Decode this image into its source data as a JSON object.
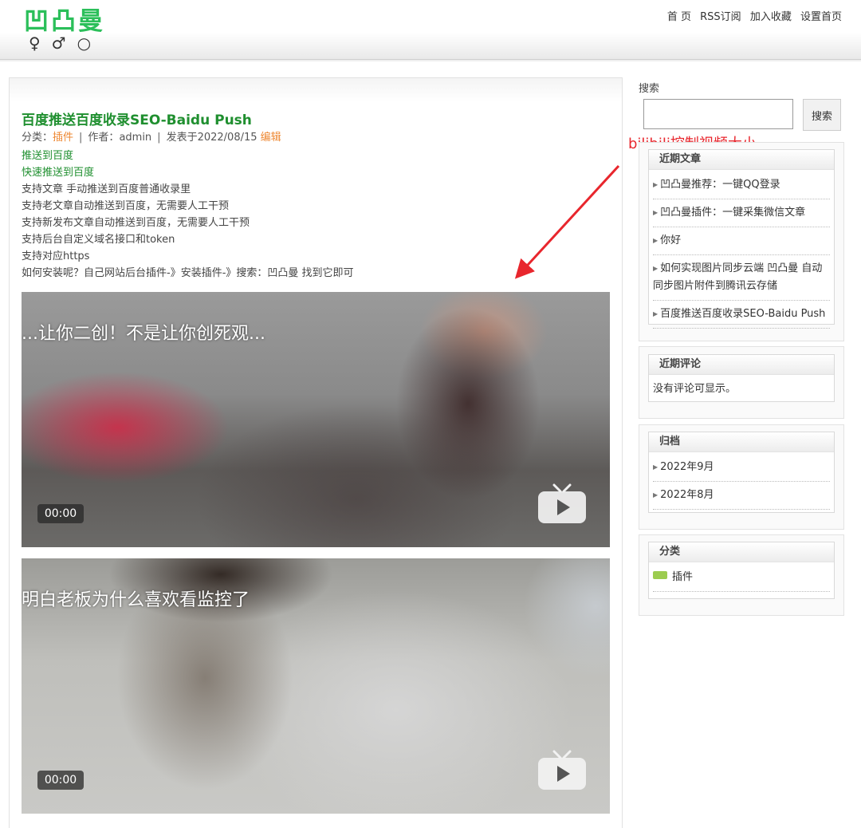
{
  "header": {
    "logo_text": "凹凸曼",
    "logo_symbols": "♀♂○",
    "nav": [
      "首 页",
      "RSS订阅",
      "加入收藏",
      "设置首页"
    ]
  },
  "post": {
    "title": "百度推送百度收录SEO-Baidu Push",
    "meta": {
      "category_label": "分类：",
      "category": "插件",
      "author_label": "作者：",
      "author": "admin",
      "date_label": "发表于",
      "date": "2022/08/15",
      "edit": "编辑",
      "separator": "|"
    },
    "body_lines": [
      "推送到百度",
      "快速推送到百度",
      "支持文章 手动推送到百度普通收录里",
      "支持老文章自动推送到百度，无需要人工干预",
      "支持新发布文章自动推送到百度，无需要人工干预",
      "支持后台自定义域名接口和token",
      "支持对应https",
      "如何安装呢？自己网站后台插件-》安装插件-》搜索：凹凸曼 找到它即可"
    ],
    "videos": [
      {
        "title": "...让你二创！不是让你创死观...",
        "time": "00:00",
        "icon": "tv-play-icon"
      },
      {
        "title": "明白老板为什么喜欢看监控了",
        "time": "00:00",
        "icon": "tv-play-icon"
      }
    ]
  },
  "annotation": {
    "text": "bilibili控制视频大小",
    "color": "#e8262d"
  },
  "sidebar": {
    "search_label": "搜索",
    "search_value": "",
    "search_button": "搜索",
    "recent_posts": {
      "title": "近期文章",
      "items": [
        "凹凸曼推荐：一键QQ登录",
        "凹凸曼插件：一键采集微信文章",
        "你好",
        "如何实现图片同步云端 凹凸曼 自动同步图片附件到腾讯云存储",
        "百度推送百度收录SEO-Baidu Push"
      ]
    },
    "recent_comments": {
      "title": "近期评论",
      "empty_text": "没有评论可显示。"
    },
    "archives": {
      "title": "归档",
      "items": [
        "2022年9月",
        "2022年8月"
      ]
    },
    "categories": {
      "title": "分类",
      "items": [
        "插件"
      ]
    }
  },
  "colors": {
    "brand_green": "#2bbf5a",
    "title_green": "#1f8f2f",
    "link_orange": "#ee8833",
    "category_chip": "#9ccc4f"
  }
}
